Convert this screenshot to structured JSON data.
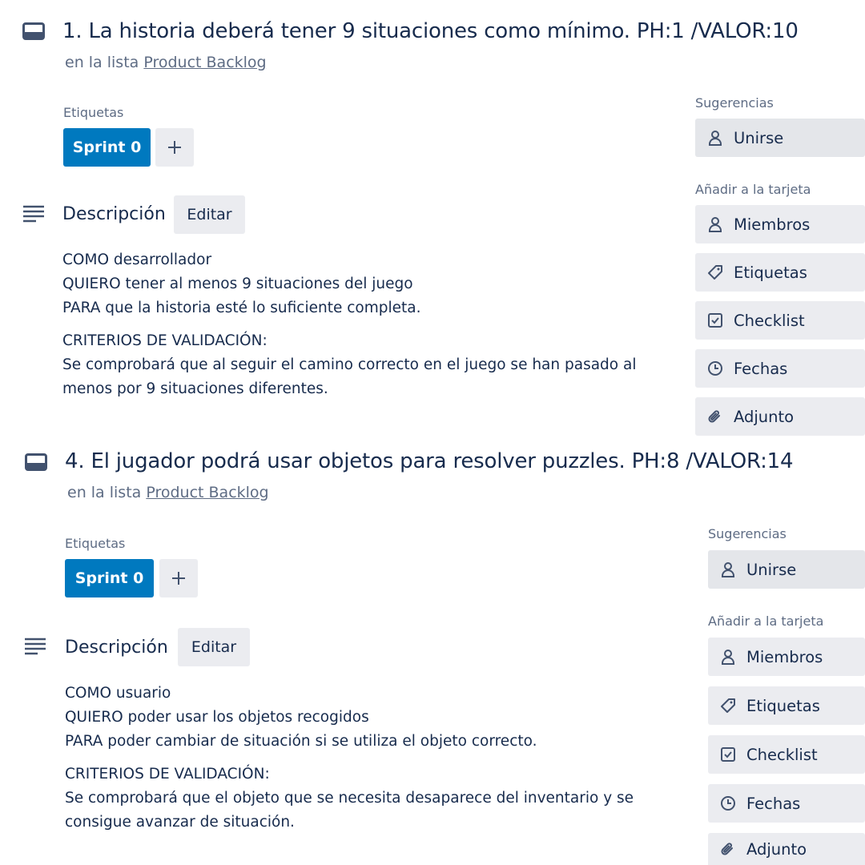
{
  "cards": [
    {
      "title": "1. La historia deberá tener 9 situaciones como mínimo. PH:1 /VALOR:10",
      "in_list_prefix": "en la lista",
      "list_name": "Product Backlog",
      "labels_header": "Etiquetas",
      "label": "Sprint 0",
      "description_header": "Descripción",
      "edit_label": "Editar",
      "description": {
        "line1": "COMO desarrollador",
        "line2": "QUIERO tener al menos 9 situaciones del juego",
        "line3": "PARA que la historia esté lo suficiente completa.",
        "criteria_header": "CRITERIOS DE VALIDACIÓN:",
        "criteria_line1": "Se comprobará que al seguir el camino correcto en el juego se han pasado al",
        "criteria_line2": "menos por 9 situaciones diferentes."
      },
      "suggestions_header": "Sugerencias",
      "join_label": "Unirse",
      "add_to_card_header": "Añadir a la tarjeta",
      "actions": {
        "members": "Miembros",
        "labels": "Etiquetas",
        "checklist": "Checklist",
        "dates": "Fechas",
        "attachment": "Adjunto"
      }
    },
    {
      "title": "4. El jugador podrá usar objetos para resolver puzzles. PH:8 /VALOR:14",
      "in_list_prefix": "en la lista",
      "list_name": "Product Backlog",
      "labels_header": "Etiquetas",
      "label": "Sprint 0",
      "description_header": "Descripción",
      "edit_label": "Editar",
      "description": {
        "line1": "COMO usuario",
        "line2": "QUIERO poder usar los objetos recogidos",
        "line3": "PARA poder cambiar de situación si se utiliza el objeto correcto.",
        "criteria_header": "CRITERIOS DE VALIDACIÓN:",
        "criteria_line1": "Se comprobará que el objeto que se necesita desaparece del inventario y se",
        "criteria_line2": "consigue avanzar de situación."
      },
      "suggestions_header": "Sugerencias",
      "join_label": "Unirse",
      "add_to_card_header": "Añadir a la tarjeta",
      "actions": {
        "members": "Miembros",
        "labels": "Etiquetas",
        "checklist": "Checklist",
        "dates": "Fechas",
        "attachment": "Adjunto"
      }
    }
  ],
  "colors": {
    "label_blue": "#0079bf",
    "button_gray": "#ebecf0",
    "text_primary": "#172b4d",
    "text_secondary": "#5e6c84"
  },
  "icons": {
    "card": "card-icon",
    "description": "description-lines-icon",
    "person": "person-icon",
    "tag": "tag-icon",
    "checkbox": "checkbox-icon",
    "clock": "clock-icon",
    "paperclip": "paperclip-icon",
    "plus": "plus-icon"
  }
}
